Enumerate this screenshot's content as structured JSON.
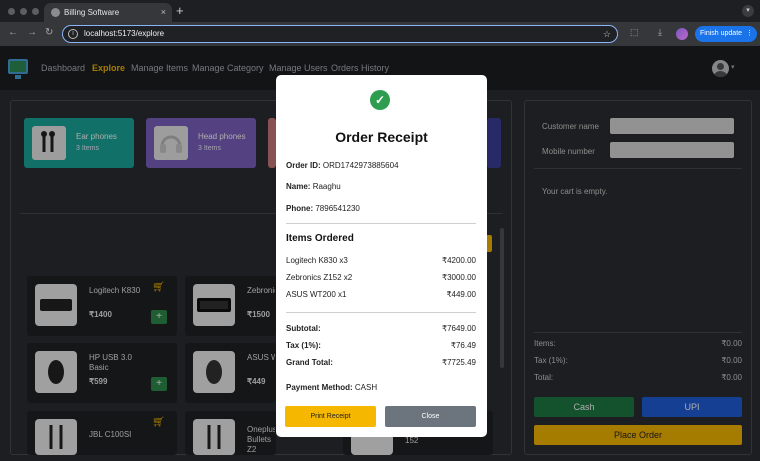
{
  "browser": {
    "tab_title": "Billing Software",
    "tab_close": "×",
    "new_tab": "+",
    "url": "localhost:5173/explore",
    "finish_update": "Finish update"
  },
  "nav": {
    "links": [
      "Dashboard",
      "Explore",
      "Manage Items",
      "Manage Category",
      "Manage Users",
      "Orders History"
    ],
    "active": "Explore"
  },
  "categories": [
    {
      "name": "Ear phones",
      "count": "3 Items",
      "color": "#1aa79a"
    },
    {
      "name": "Head phones",
      "count": "3 Items",
      "color": "#7b61c0"
    }
  ],
  "items": [
    {
      "name": "Logitech K830",
      "price": "₹1400"
    },
    {
      "name": "Zebronics Z152",
      "price": "₹1500"
    },
    {
      "name": "HP USB 3.0 Basic",
      "price": "₹599"
    },
    {
      "name": "ASUS WT200",
      "price": "₹449"
    },
    {
      "name": "JBL C100SI",
      "price": ""
    },
    {
      "name": "Oneplus Bullets Z2",
      "price": ""
    },
    {
      "name": "152",
      "price": ""
    }
  ],
  "cart": {
    "customer_label": "Customer name",
    "mobile_label": "Mobile number",
    "empty_text": "Your cart is empty.",
    "items_label": "Items:",
    "items_value": "₹0.00",
    "tax_label": "Tax (1%):",
    "tax_value": "₹0.00",
    "total_label": "Total:",
    "total_value": "₹0.00",
    "cash_label": "Cash",
    "upi_label": "UPI",
    "place_order_label": "Place Order"
  },
  "receipt": {
    "title": "Order Receipt",
    "order_id_label": "Order ID:",
    "order_id": "ORD1742973885604",
    "name_label": "Name:",
    "name": "Raaghu",
    "phone_label": "Phone:",
    "phone": "7896541230",
    "items_heading": "Items Ordered",
    "lines": [
      {
        "item": "Logitech K830 x3",
        "amount": "₹4200.00"
      },
      {
        "item": "Zebronics Z152 x2",
        "amount": "₹3000.00"
      },
      {
        "item": "ASUS WT200 x1",
        "amount": "₹449.00"
      }
    ],
    "subtotal_label": "Subtotal:",
    "subtotal": "₹7649.00",
    "tax_label": "Tax (1%):",
    "tax": "₹76.49",
    "grand_label": "Grand Total:",
    "grand_total": "₹7725.49",
    "payment_label": "Payment Method:",
    "payment_method": "CASH",
    "print_label": "Print Receipt",
    "close_label": "Close"
  },
  "colors": {
    "accent": "#f5b700",
    "success": "#2e9d4f",
    "cash": "#1e7a45",
    "upi": "#1e5ed9"
  }
}
